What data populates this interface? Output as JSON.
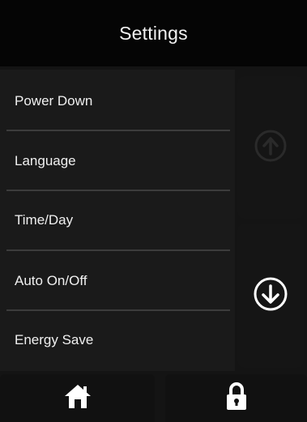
{
  "header": {
    "title": "Settings"
  },
  "menu": {
    "items": [
      {
        "label": "Power Down"
      },
      {
        "label": "Language"
      },
      {
        "label": "Time/Day"
      },
      {
        "label": "Auto On/Off"
      },
      {
        "label": "Energy Save"
      }
    ]
  },
  "scroll": {
    "up_icon": "arrow-up-circle-icon",
    "up_state": "disabled",
    "down_icon": "arrow-down-circle-icon",
    "down_state": "enabled"
  },
  "footer": {
    "home_icon": "home-icon",
    "lock_icon": "lock-icon"
  },
  "colors": {
    "background": "#141414",
    "header_background": "#050505",
    "text": "#f0f0f0",
    "divider": "#3c3c3c",
    "icon_active": "#ffffff",
    "icon_disabled": "#2a2a2a"
  }
}
